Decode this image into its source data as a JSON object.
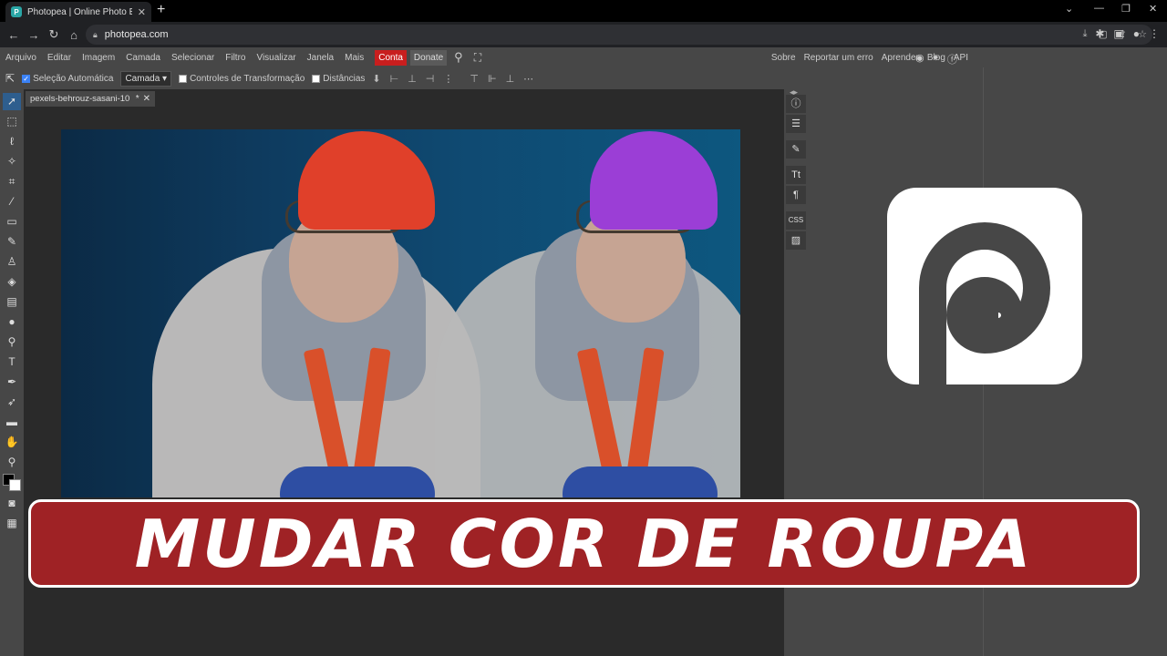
{
  "browser": {
    "tab_title": "Photopea | Online Photo Editor",
    "tab_close": "✕",
    "new_tab": "+",
    "url": "photopea.com",
    "window_controls": [
      "⌄",
      "—",
      "❐",
      "✕"
    ]
  },
  "menu": {
    "items": [
      "Arquivo",
      "Editar",
      "Imagem",
      "Camada",
      "Selecionar",
      "Filtro",
      "Visualizar",
      "Janela",
      "Mais"
    ],
    "conta": "Conta",
    "donate": "Donate",
    "right_links": [
      "Sobre",
      "Reportar um erro",
      "Aprender",
      "Blog",
      "API"
    ]
  },
  "options": {
    "auto_select_label": "Seleção Automática",
    "auto_select_checked": true,
    "layer_select_value": "Camada",
    "transform_label": "Controles de Transformação",
    "distances_label": "Distâncias"
  },
  "document": {
    "tab_name": "pexels-behrouz-sasani-10",
    "tab_modified": "*",
    "tab_close": "✕"
  },
  "colors": {
    "hat_left": "#e0402a",
    "hat_right": "#9b3ed6",
    "banner": "#9f2225",
    "conta_bg": "#c81e1e"
  },
  "banner": {
    "text": "MUDAR COR DE ROUPA"
  },
  "right_panel": {
    "buttons": [
      "info-icon",
      "adjust-icon",
      "brush-icon",
      "char-icon",
      "paragraph-icon",
      "css-label",
      "image-icon"
    ],
    "css_label": "CSS"
  }
}
